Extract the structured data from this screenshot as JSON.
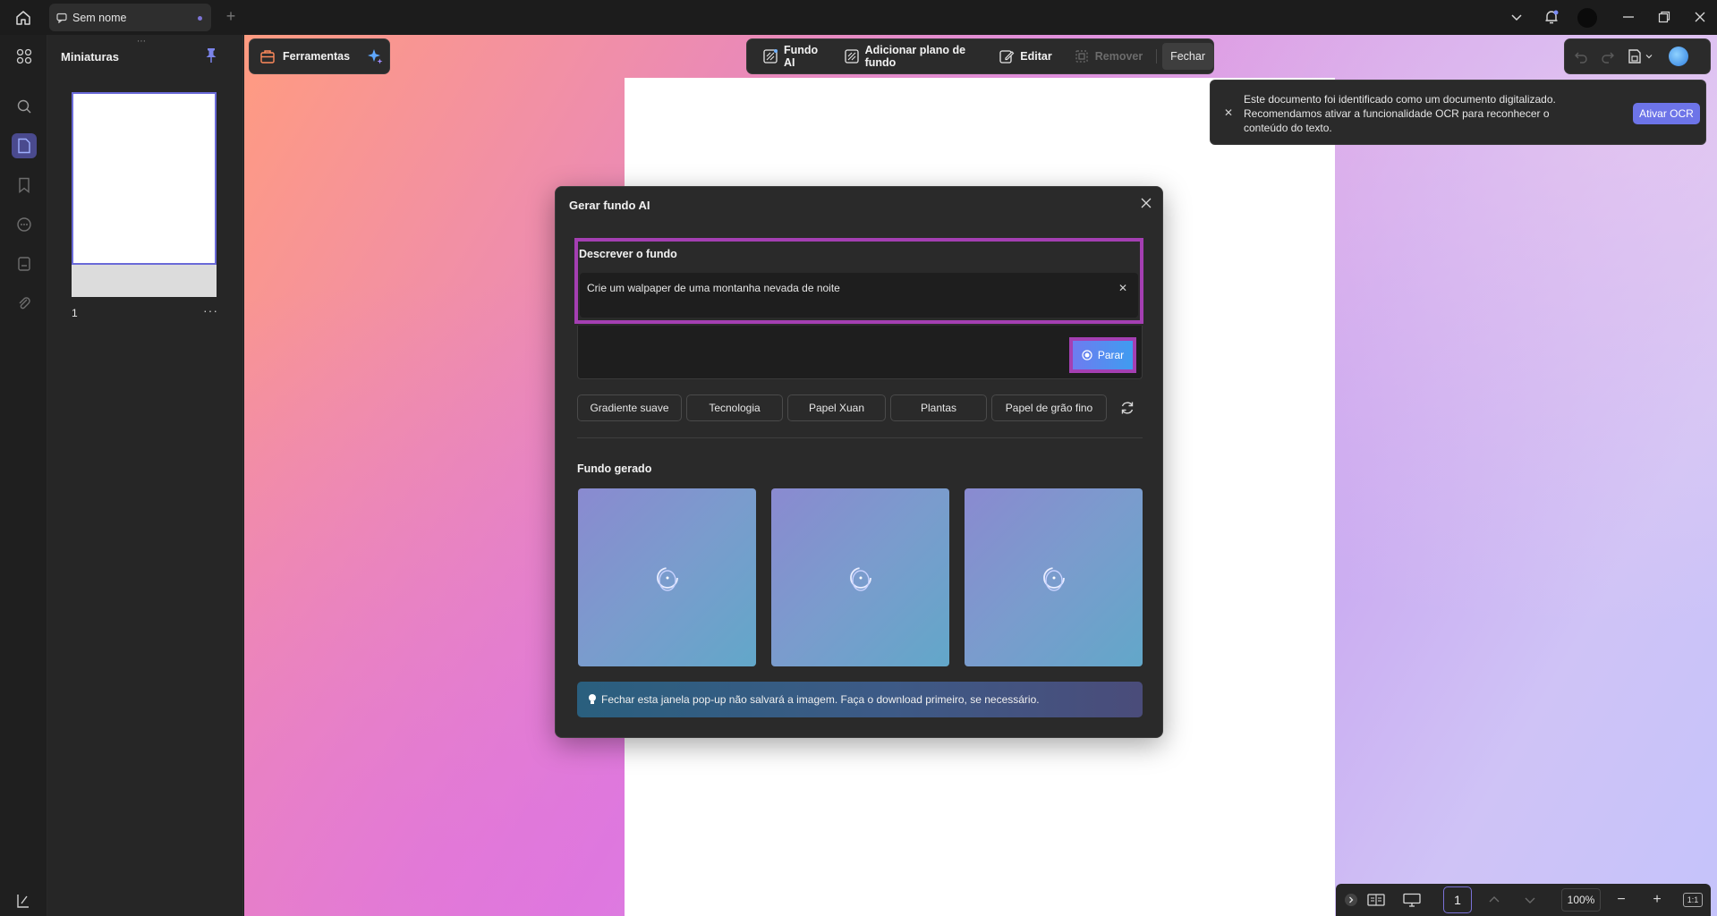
{
  "titlebar": {
    "tab_label": "Sem nome",
    "tab_add": "+"
  },
  "thumbnails": {
    "title": "Miniaturas",
    "grip": "⋯",
    "page_number": "1",
    "page_more": "···"
  },
  "tools": {
    "label": "Ferramentas"
  },
  "bg_toolbar": {
    "ai_bg": "Fundo AI",
    "add_bg": "Adicionar plano de fundo",
    "edit": "Editar",
    "remove": "Remover",
    "close": "Fechar"
  },
  "ocr": {
    "message": "Este documento foi identificado como um documento digitalizado. Recomendamos ativar a funcionalidade OCR para reconhecer o conteúdo do texto.",
    "button": "Ativar OCR",
    "close": "✕"
  },
  "modal": {
    "title": "Gerar fundo AI",
    "describe_label": "Descrever o fundo",
    "prompt_value": "Crie um walpaper de uma montanha nevada de noite",
    "clear": "✕",
    "stop_label": "Parar",
    "chips": [
      "Gradiente suave",
      "Tecnologia",
      "Papel Xuan",
      "Plantas",
      "Papel de grão fino"
    ],
    "generated_label": "Fundo gerado",
    "tip": "Fechar esta janela pop-up não salvará a imagem. Faça o download primeiro, se necessário."
  },
  "statusbar": {
    "page": "1",
    "zoom": "100%",
    "minus": "−",
    "plus": "+",
    "fit": "1:1"
  },
  "colors": {
    "accent": "#6d74e8",
    "highlight": "#a43fb2"
  }
}
